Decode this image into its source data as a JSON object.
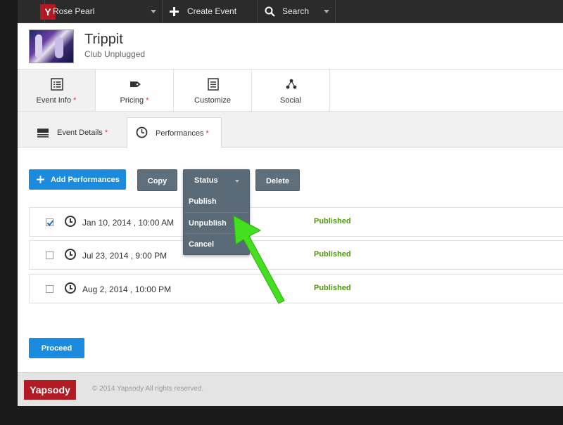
{
  "topbar": {
    "logo_letter": "Y",
    "account_name": "Rose Pearl",
    "create_event": "Create Event",
    "search": "Search"
  },
  "event": {
    "title": "Trippit",
    "venue": "Club Unplugged"
  },
  "main_tabs": [
    {
      "label": "Event Info",
      "required": "*"
    },
    {
      "label": "Pricing",
      "required": "*"
    },
    {
      "label": "Customize",
      "required": ""
    },
    {
      "label": "Social",
      "required": ""
    }
  ],
  "sub_tabs": [
    {
      "label": "Event Details",
      "required": "*"
    },
    {
      "label": "Performances",
      "required": "*"
    }
  ],
  "toolbar": {
    "add_label": "Add Performances",
    "copy_label": "Copy",
    "status_label": "Status",
    "delete_label": "Delete"
  },
  "status_menu": {
    "items": [
      "Publish",
      "Unpublish",
      "Cancel"
    ]
  },
  "performances": [
    {
      "date": "Jan 10, 2014 , 10:00 AM",
      "status": "Published",
      "checked": true
    },
    {
      "date": "Jul 23, 2014 , 9:00 PM",
      "status": "Published",
      "checked": false
    },
    {
      "date": "Aug 2, 2014 , 10:00 PM",
      "status": "Published",
      "checked": false
    }
  ],
  "proceed_label": "Proceed",
  "footer": {
    "logo_text": "Yapsody",
    "copyright": "© 2014 Yapsody All rights reserved."
  },
  "colors": {
    "accent_blue": "#1b8be0",
    "brand_red": "#b21a24",
    "status_green": "#4e9a06",
    "button_gray": "#5f6f7c",
    "arrow_green": "#44e020"
  }
}
